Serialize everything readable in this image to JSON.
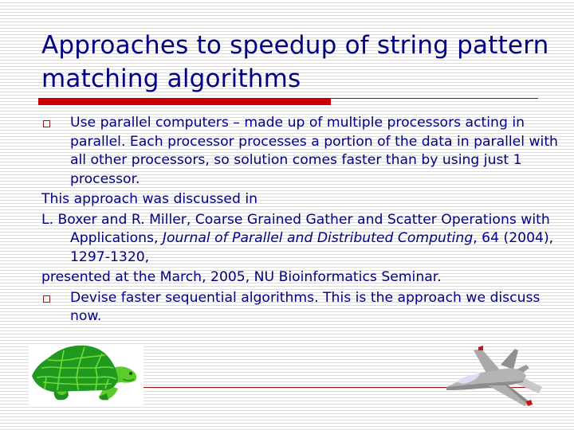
{
  "slide": {
    "title": "Approaches to speedup of string pattern matching algorithms",
    "bullets": [
      {
        "text": "Use parallel computers – made up of multiple processors acting in parallel.  Each processor processes a portion of the data in parallel with all other processors, so solution comes faster than by using just 1 processor."
      },
      {
        "text": "Devise faster sequential algorithms.  This is the approach we discuss now."
      }
    ],
    "discussion_intro": "This approach was discussed in",
    "citation": {
      "authors_title": "L. Boxer and R. Miller, Coarse Grained Gather and Scatter Operations with Applications, ",
      "journal": "Journal of Parallel and Distributed Computing",
      "details": ", 64 (2004), 1297-1320,"
    },
    "presented_note": "presented at the March, 2005, NU Bioinformatics Seminar.",
    "images": {
      "left": "turtle-clipart",
      "right": "fighter-jet-clipart"
    },
    "colors": {
      "text": "#000080",
      "accent_bar": "#c80000",
      "bullet": "#8b1a1a"
    }
  }
}
